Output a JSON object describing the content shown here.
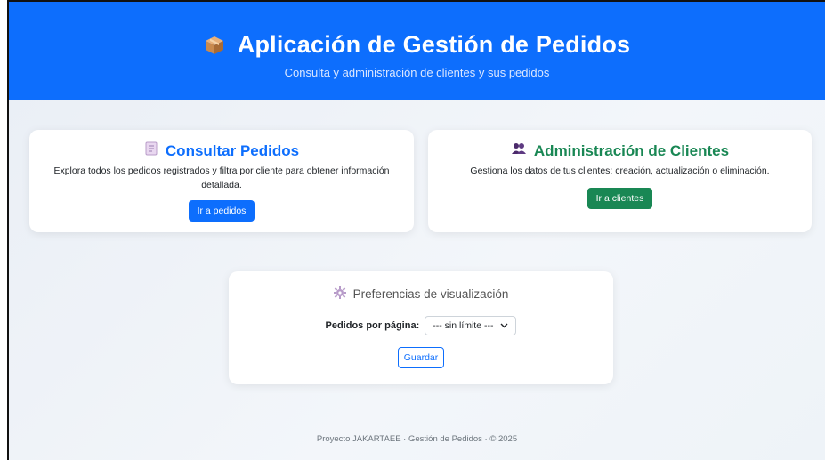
{
  "header": {
    "title": "Aplicación de Gestión de Pedidos",
    "subtitle": "Consulta y administración de clientes y sus pedidos",
    "icon": "package-icon"
  },
  "cards": {
    "orders": {
      "title": "Consultar Pedidos",
      "description": "Explora todos los pedidos registrados y filtra por cliente para obtener información detallada.",
      "button": "Ir a pedidos",
      "icon": "notepad-icon"
    },
    "clients": {
      "title": "Administración de Clientes",
      "description": "Gestiona los datos de tus clientes: creación, actualización o eliminación.",
      "button": "Ir a clientes",
      "icon": "users-icon"
    }
  },
  "preferences": {
    "title": "Preferencias de visualización",
    "label": "Pedidos por página:",
    "selected": "--- sin límite ---",
    "save": "Guardar",
    "icon": "gear-icon"
  },
  "footer": {
    "text": "Proyecto JAKARTAEE · Gestión de Pedidos · © 2025"
  },
  "colors": {
    "primary": "#0d6efd",
    "success": "#198754"
  }
}
